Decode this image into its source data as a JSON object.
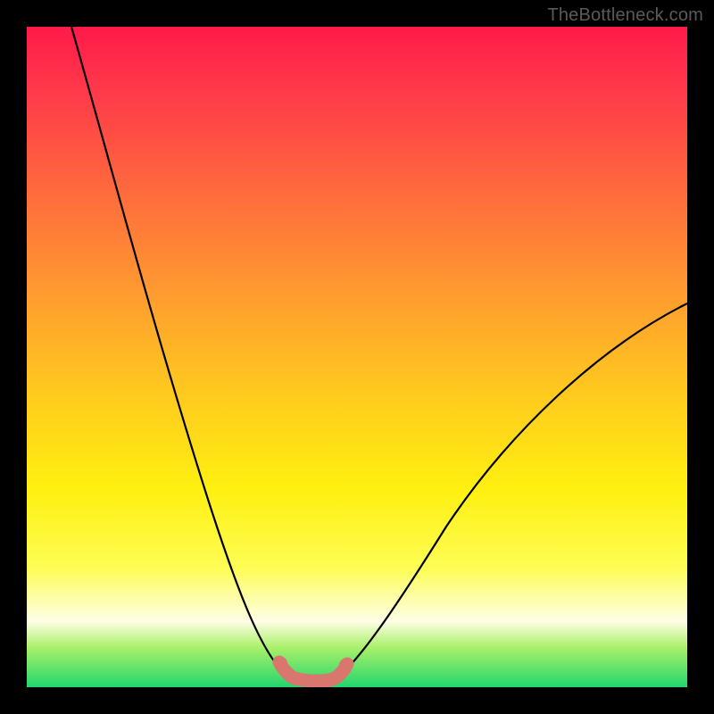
{
  "attribution": "TheBottleneck.com",
  "chart_data": {
    "type": "line",
    "title": "",
    "xlabel": "",
    "ylabel": "",
    "xlim": [
      0,
      100
    ],
    "ylim": [
      0,
      100
    ],
    "grid": false,
    "legend": false,
    "background": "rainbow-vertical-gradient",
    "series": [
      {
        "name": "left-curve",
        "x": [
          0,
          6,
          12,
          18,
          24,
          28,
          31,
          34,
          36,
          37.5,
          38.5
        ],
        "values": [
          100,
          85,
          68,
          50,
          32,
          20,
          12,
          6,
          3,
          1.5,
          1
        ]
      },
      {
        "name": "trough-band",
        "x": [
          38.5,
          40,
          42,
          44,
          46,
          47.5
        ],
        "values": [
          1,
          0.8,
          0.7,
          0.7,
          0.9,
          1.2
        ],
        "display": "thick-marker-band",
        "color": "#d9766e"
      },
      {
        "name": "right-curve",
        "x": [
          47.5,
          50,
          55,
          62,
          70,
          80,
          90,
          100
        ],
        "values": [
          1.2,
          3,
          8,
          17,
          27,
          38,
          48,
          57
        ]
      }
    ],
    "annotations": []
  }
}
